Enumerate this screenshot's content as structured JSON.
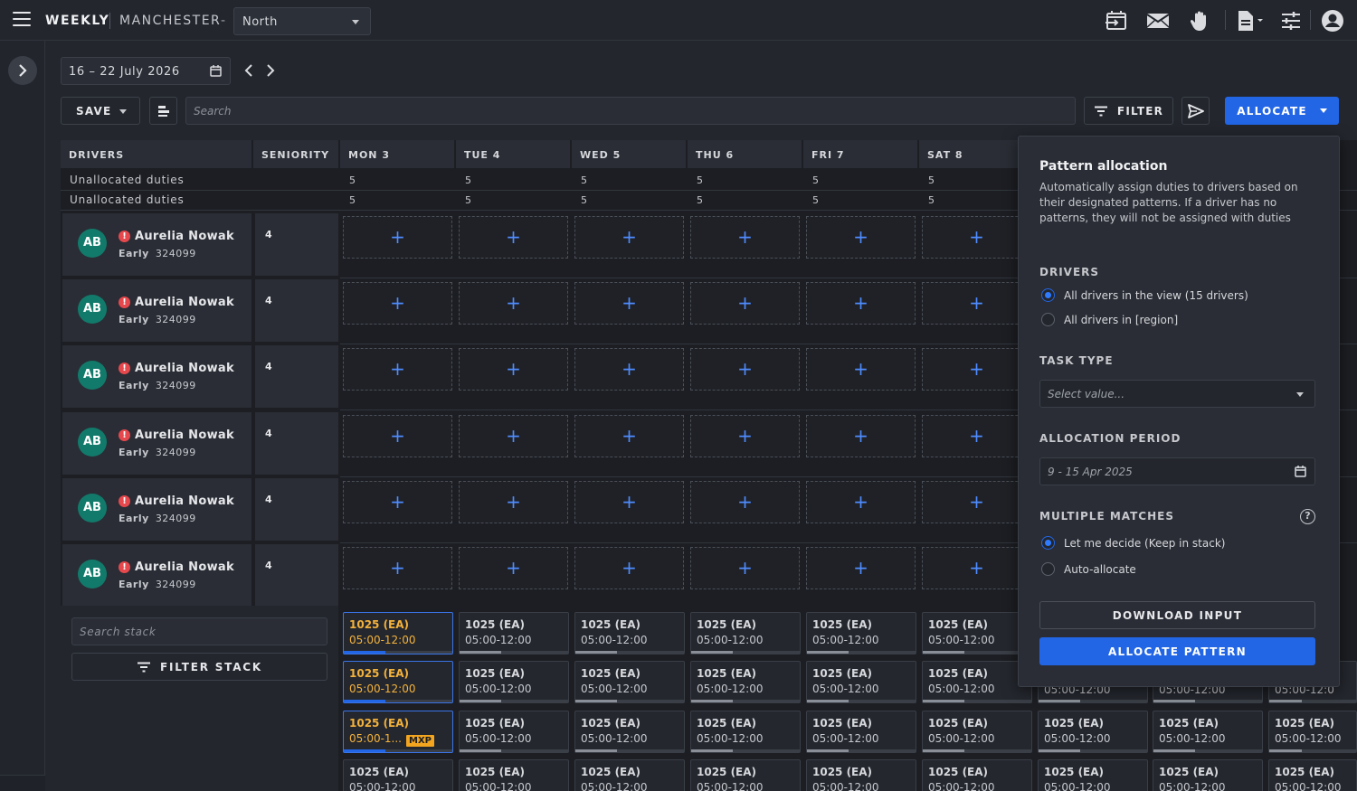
{
  "topbar": {
    "view_label": "WEEKLY",
    "location": "MANCHESTER",
    "dash": "-",
    "region": "North"
  },
  "icons": {
    "menu": "hamburger-icon",
    "swap": "swap-calendar-icon",
    "mail": "mail-icon",
    "hand": "hand-icon",
    "document": "document-icon",
    "sliders": "sliders-icon",
    "account": "account-circle-icon"
  },
  "date_nav": {
    "range": "16 – 22 July 2026"
  },
  "toolbar": {
    "save_label": "SAVE",
    "search_placeholder": "Search",
    "filter_label": "FILTER",
    "allocate_label": "ALLOCATE"
  },
  "table": {
    "headers": [
      "DRIVERS",
      "SENIORITY",
      "MON 3",
      "TUE 4",
      "WED 5",
      "THU 6",
      "FRI 7",
      "SAT 8"
    ],
    "unallocated_rows": [
      {
        "label": "Unallocated duties",
        "values": [
          "5",
          "5",
          "5",
          "5",
          "5",
          "5"
        ]
      },
      {
        "label": "Unallocated duties",
        "values": [
          "5",
          "5",
          "5",
          "5",
          "5",
          "5"
        ]
      }
    ],
    "drivers": [
      {
        "initials": "AB",
        "name": "Aurelia Nowak",
        "shift": "Early",
        "id": "324099",
        "seniority": "4"
      },
      {
        "initials": "AB",
        "name": "Aurelia Nowak",
        "shift": "Early",
        "id": "324099",
        "seniority": "4"
      },
      {
        "initials": "AB",
        "name": "Aurelia Nowak",
        "shift": "Early",
        "id": "324099",
        "seniority": "4"
      },
      {
        "initials": "AB",
        "name": "Aurelia Nowak",
        "shift": "Early",
        "id": "324099",
        "seniority": "4"
      },
      {
        "initials": "AB",
        "name": "Aurelia Nowak",
        "shift": "Early",
        "id": "324099",
        "seniority": "4"
      },
      {
        "initials": "AB",
        "name": "Aurelia Nowak",
        "shift": "Early",
        "id": "324099",
        "seniority": "4"
      }
    ],
    "slot_symbol": "+"
  },
  "stack": {
    "search_placeholder": "Search stack",
    "filter_label": "FILTER STACK",
    "card_title": "1025 (EA)",
    "card_time": "05:00-12:00",
    "card_time_truncated": "05:00-1...",
    "badge": "MXP",
    "partial_time_1": "05:00-12:00",
    "partial_time_2": "05:00-12:0",
    "partial_title_1": "1025 (EA)"
  },
  "popover": {
    "title": "Pattern allocation",
    "description": "Automatically assign duties to drivers based on their designated patterns. If a driver has no patterns, they will not be assigned with duties",
    "drivers_heading": "DRIVERS",
    "drivers_option_1": "All drivers in the view (15 drivers)",
    "drivers_option_2": "All drivers in [region]",
    "task_type_heading": "TASK TYPE",
    "task_type_placeholder": "Select value...",
    "period_heading": "ALLOCATION PERIOD",
    "period_value": "9 - 15 Apr 2025",
    "multiple_heading": "MULTIPLE MATCHES",
    "help_symbol": "?",
    "multiple_option_1": "Let me decide (Keep in stack)",
    "multiple_option_2": "Auto-allocate",
    "download_label": "DOWNLOAD INPUT",
    "allocate_label": "ALLOCATE PATTERN"
  },
  "colors": {
    "accent": "#2266e6",
    "background": "#23262d",
    "avatar": "#127a6b",
    "warning": "#e5484d",
    "selected_text": "#f3b23c",
    "badge": "#f3a51f"
  }
}
